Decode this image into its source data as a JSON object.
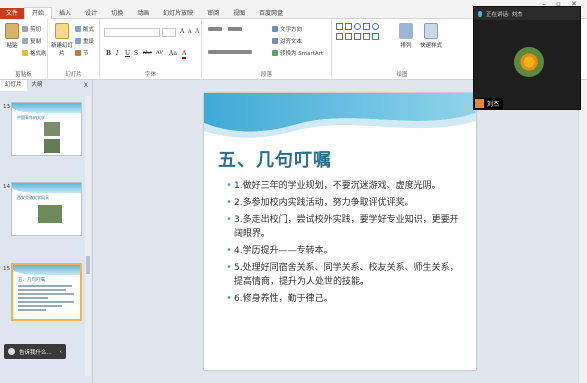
{
  "window": {
    "controls": "– ▫ ✕"
  },
  "tabs": [
    {
      "label": "文件",
      "name": "file"
    },
    {
      "label": "开始",
      "name": "home"
    },
    {
      "label": "插入",
      "name": "insert"
    },
    {
      "label": "设计",
      "name": "design"
    },
    {
      "label": "切换",
      "name": "transitions"
    },
    {
      "label": "动画",
      "name": "animations"
    },
    {
      "label": "幻灯片放映",
      "name": "slideshow"
    },
    {
      "label": "审阅",
      "name": "review"
    },
    {
      "label": "视图",
      "name": "view"
    },
    {
      "label": "百度网盘",
      "name": "baidu"
    }
  ],
  "ribbon": {
    "clipboard": {
      "paste": "粘贴",
      "cut": "剪切",
      "copy": "复制",
      "format_painter": "格式刷",
      "label": "剪贴板"
    },
    "slides": {
      "new_slide": "新建幻灯片",
      "layout": "版式",
      "reset": "重设",
      "section": "节",
      "label": "幻灯片"
    },
    "font": {
      "label": "字体",
      "bold": "B",
      "italic": "I",
      "underline": "U",
      "strike": "S",
      "abc": "abc",
      "av": "AV",
      "aa": "Aa",
      "grow": "A",
      "shrink": "A",
      "clear": "A",
      "color": "A"
    },
    "paragraph": {
      "label": "段落",
      "text_direction": "文字方向",
      "align_text": "对齐文本",
      "smartart": "转换为 SmartArt"
    },
    "drawing": {
      "label": "绘图",
      "arrange": "排列",
      "quick_styles": "快速样式",
      "shape_fill": "形状填充",
      "shape_outline": "形状轮廓",
      "shape_effects": "形状效果"
    }
  },
  "left_panel": {
    "tab_slides": "幻灯片",
    "tab_outline": "大纲",
    "close": "X",
    "thumbs": [
      {
        "num": "13",
        "title": "中国青年的大学"
      },
      {
        "num": "14",
        "title": "西安交通大学风采"
      },
      {
        "num": "15",
        "title": "五、几句叮嘱"
      }
    ]
  },
  "search": {
    "label": "告诉我什么..."
  },
  "slide": {
    "title": "五、几句叮嘱",
    "bullets": [
      "1.做好三年的学业规划，不要沉迷游戏、虚度光阴。",
      "2.多参加校内实践活动，努力争取评优评奖。",
      "3.多走出校门，尝试校外实践，要学好专业知识，更要开阔眼界。",
      "4.学历提升——专转本。",
      "5.处理好同宿舍关系、同学关系、校友关系、师生关系，提高情商，提升为人处世的技能。",
      "6.修身养性，勤于律己。"
    ]
  },
  "video": {
    "speaking": "正在讲话: 刘杰",
    "name": "刘杰"
  },
  "colors": {
    "accent": "#2a6f8f",
    "file_tab": "#c43e1c",
    "bullet": "#4aa6c7",
    "selection": "#f0b35a"
  }
}
